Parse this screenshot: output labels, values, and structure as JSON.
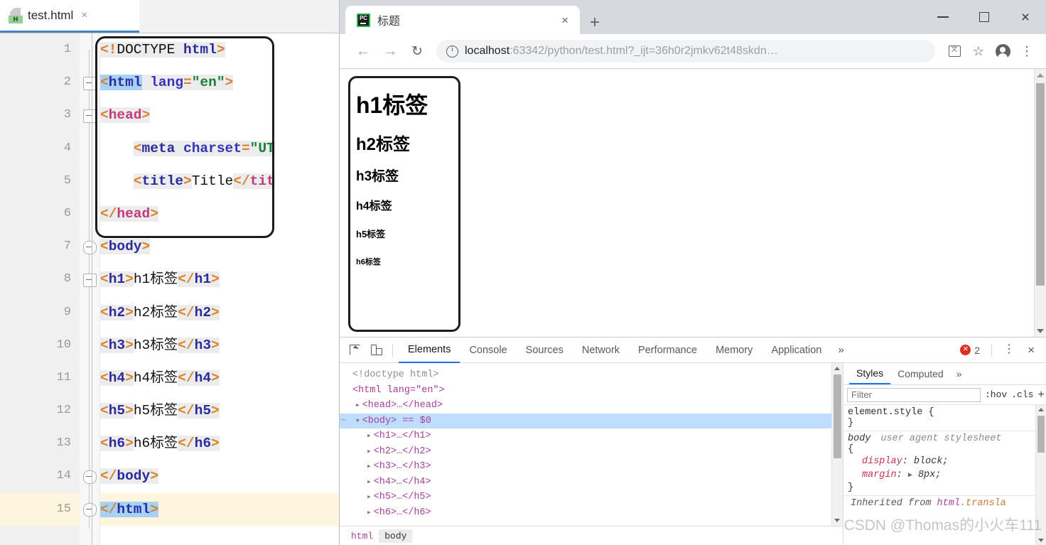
{
  "ide": {
    "tab": {
      "label": "test.html",
      "icon": "html-file-icon",
      "badge": "H",
      "close": "×"
    },
    "lines": [
      {
        "num": "1",
        "text": "<!DOCTYPE html>"
      },
      {
        "num": "2",
        "text": "<html lang=\"en\">"
      },
      {
        "num": "3",
        "text": "<head>"
      },
      {
        "num": "4",
        "text": "    <meta charset=\"UT"
      },
      {
        "num": "5",
        "text": "    <title>Title</tit"
      },
      {
        "num": "6",
        "text": "</head>"
      },
      {
        "num": "7",
        "text": "<body>"
      },
      {
        "num": "8",
        "text": "<h1>h1标签</h1>"
      },
      {
        "num": "9",
        "text": "<h2>h2标签</h2>"
      },
      {
        "num": "10",
        "text": "<h3>h3标签</h3>"
      },
      {
        "num": "11",
        "text": "<h4>h4标签</h4>"
      },
      {
        "num": "12",
        "text": "<h5>h5标签</h5>"
      },
      {
        "num": "13",
        "text": "<h6>h6标签</h6>"
      },
      {
        "num": "14",
        "text": "</body>"
      },
      {
        "num": "15",
        "text": "</html>"
      }
    ],
    "current_line": "15"
  },
  "browser": {
    "tab": {
      "title": "标题",
      "favicon": "pycharm-icon",
      "close_label": "×"
    },
    "new_tab_label": "+",
    "window_controls": {
      "minimize": "–",
      "maximize": "□",
      "close": "×"
    },
    "nav": {
      "back": "←",
      "forward": "→",
      "reload": "↻"
    },
    "url": {
      "host": "localhost",
      "rest": ":63342/python/test.html?_ijt=36h0r2jmkv62t48skdn…",
      "full": "localhost:63342/python/test.html?_ijt=36h0r2jmkv62t48skdn…"
    },
    "omni_icons": [
      "translate-icon",
      "star-icon",
      "profile-avatar-icon",
      "chrome-menu-icon"
    ]
  },
  "page": {
    "headings": [
      {
        "tag": "h1",
        "text": "h1标签"
      },
      {
        "tag": "h2",
        "text": "h2标签"
      },
      {
        "tag": "h3",
        "text": "h3标签"
      },
      {
        "tag": "h4",
        "text": "h4标签"
      },
      {
        "tag": "h5",
        "text": "h5标签"
      },
      {
        "tag": "h6",
        "text": "h6标签"
      }
    ]
  },
  "devtools": {
    "tabs": [
      {
        "label": "Elements",
        "active": true
      },
      {
        "label": "Console",
        "active": false
      },
      {
        "label": "Sources",
        "active": false
      },
      {
        "label": "Network",
        "active": false
      },
      {
        "label": "Performance",
        "active": false
      },
      {
        "label": "Memory",
        "active": false
      },
      {
        "label": "Application",
        "active": false
      }
    ],
    "more_label": "»",
    "error_count": "2",
    "kebab_label": "⋮",
    "close_label": "×",
    "dom": [
      {
        "indent": 0,
        "twisty": "",
        "text": "<!doctype html>",
        "kind": "doctype"
      },
      {
        "indent": 0,
        "twisty": "",
        "text": "<html lang=\"en\">",
        "kind": "open"
      },
      {
        "indent": 1,
        "twisty": "▸",
        "text": "<head>…</head>",
        "kind": "collapsed"
      },
      {
        "indent": 1,
        "twisty": "▾",
        "text": "<body> == $0",
        "kind": "selected"
      },
      {
        "indent": 2,
        "twisty": "▸",
        "text": "<h1>…</h1>",
        "kind": "collapsed"
      },
      {
        "indent": 2,
        "twisty": "▸",
        "text": "<h2>…</h2>",
        "kind": "collapsed"
      },
      {
        "indent": 2,
        "twisty": "▸",
        "text": "<h3>…</h3>",
        "kind": "collapsed"
      },
      {
        "indent": 2,
        "twisty": "▸",
        "text": "<h4>…</h4>",
        "kind": "collapsed"
      },
      {
        "indent": 2,
        "twisty": "▸",
        "text": "<h5>…</h5>",
        "kind": "collapsed"
      },
      {
        "indent": 2,
        "twisty": "▸",
        "text": "<h6>…</h6>",
        "kind": "collapsed"
      }
    ],
    "breadcrumb": [
      {
        "label": "html",
        "active": false
      },
      {
        "label": "body",
        "active": true
      }
    ],
    "styles": {
      "tabs": [
        {
          "label": "Styles",
          "active": true
        },
        {
          "label": "Computed",
          "active": false
        }
      ],
      "more_label": "»",
      "filter_placeholder": "Filter",
      "hov_label": ":hov",
      "cls_label": ".cls",
      "plus_label": "+",
      "element_style_open": "element.style {",
      "element_style_close": "}",
      "ua_selector": "body",
      "ua_origin": "user agent stylesheet",
      "ua_open": "{",
      "ua_close": "}",
      "declarations": [
        {
          "prop": "display",
          "value": "block;"
        },
        {
          "prop": "margin",
          "value": "8px;",
          "expandable": true
        }
      ],
      "inherited_prefix": "Inherited from",
      "inherited_tag": "html",
      "inherited_cls": ".transla"
    }
  },
  "watermark": "CSDN @Thomas的小火车111"
}
